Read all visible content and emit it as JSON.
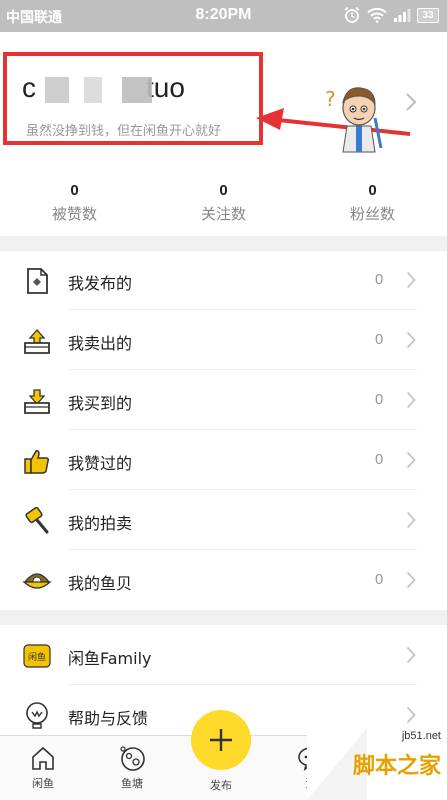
{
  "status_bar": {
    "carrier": "中国联通",
    "time": "8:20PM",
    "battery": "33"
  },
  "profile": {
    "username_visible": "tuo",
    "username_prefix": "c",
    "signature": "虽然没挣到钱，但在闲鱼开心就好"
  },
  "stats": [
    {
      "value": "0",
      "label": "被赞数"
    },
    {
      "value": "0",
      "label": "关注数"
    },
    {
      "value": "0",
      "label": "粉丝数"
    }
  ],
  "menu_primary": [
    {
      "label": "我发布的",
      "count": "0",
      "icon": "document-icon"
    },
    {
      "label": "我卖出的",
      "count": "0",
      "icon": "sell-box-icon"
    },
    {
      "label": "我买到的",
      "count": "0",
      "icon": "buy-box-icon"
    },
    {
      "label": "我赞过的",
      "count": "0",
      "icon": "thumbs-up-icon"
    },
    {
      "label": "我的拍卖",
      "count": "",
      "icon": "auction-hammer-icon"
    },
    {
      "label": "我的鱼贝",
      "count": "0",
      "icon": "shell-icon"
    }
  ],
  "menu_secondary": [
    {
      "label": "闲鱼Family",
      "icon": "family-badge-icon"
    },
    {
      "label": "帮助与反馈",
      "icon": "help-bulb-icon"
    }
  ],
  "family_badge_text": "闲鱼",
  "tabs": [
    {
      "label": "闲鱼",
      "icon": "home-icon"
    },
    {
      "label": "鱼塘",
      "icon": "pond-icon"
    },
    {
      "label": "发布",
      "icon": "plus-icon"
    },
    {
      "label": "消",
      "icon": "message-icon"
    }
  ],
  "watermark": {
    "domain": "jb51.net",
    "brand": "脚本之家"
  },
  "colors": {
    "accent_yellow": "#ffda2a",
    "highlight_red": "#e53333",
    "status_bar": "#bfbfbf"
  }
}
